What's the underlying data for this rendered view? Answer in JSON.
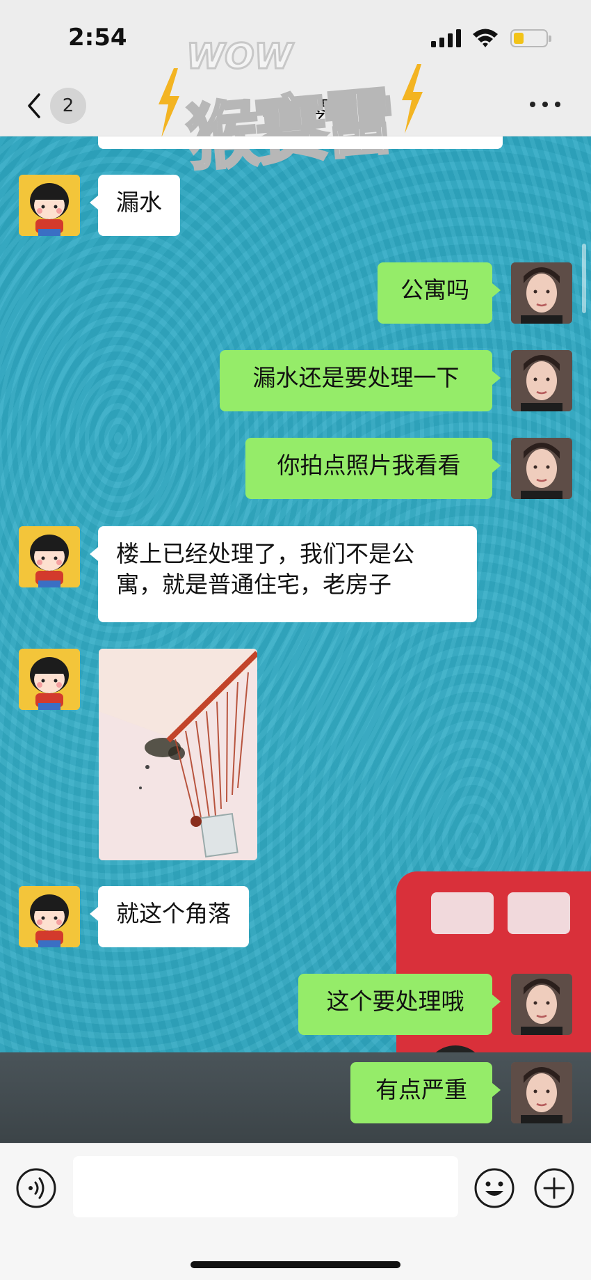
{
  "status_bar": {
    "time": "2:54"
  },
  "nav": {
    "unread_count": "2",
    "title": "孙玉琴",
    "back_icon": "chevron-left-icon",
    "more_icon": "more-dots-icon"
  },
  "watermark": {
    "small_text": "WOW",
    "main_text": "猴赛雷"
  },
  "messages": [
    {
      "side": "left",
      "type": "text",
      "text": "漏水"
    },
    {
      "side": "right",
      "type": "text",
      "text": "公寓吗"
    },
    {
      "side": "right",
      "type": "text",
      "text": "漏水还是要处理一下"
    },
    {
      "side": "right",
      "type": "text",
      "text": "你拍点照片我看看"
    },
    {
      "side": "left",
      "type": "text",
      "lines": [
        "楼上已经处理了，我们不是公",
        "寓，就是普通住宅，老房子"
      ]
    },
    {
      "side": "left",
      "type": "image",
      "description_icon": "photo-leaking-corner"
    },
    {
      "side": "left",
      "type": "text",
      "text": "就这个角落"
    },
    {
      "side": "right",
      "type": "text",
      "text": "这个要处理哦"
    },
    {
      "side": "right",
      "type": "text",
      "text": "有点严重"
    }
  ],
  "input_bar": {
    "voice_icon": "voice-icon",
    "emoji_icon": "emoji-icon",
    "plus_icon": "plus-icon",
    "input_value": ""
  },
  "colors": {
    "outgoing_bubble": "#95ec69",
    "incoming_bubble": "#ffffff",
    "chat_background": "#2fa8c2",
    "bar_background": "#ededed"
  }
}
